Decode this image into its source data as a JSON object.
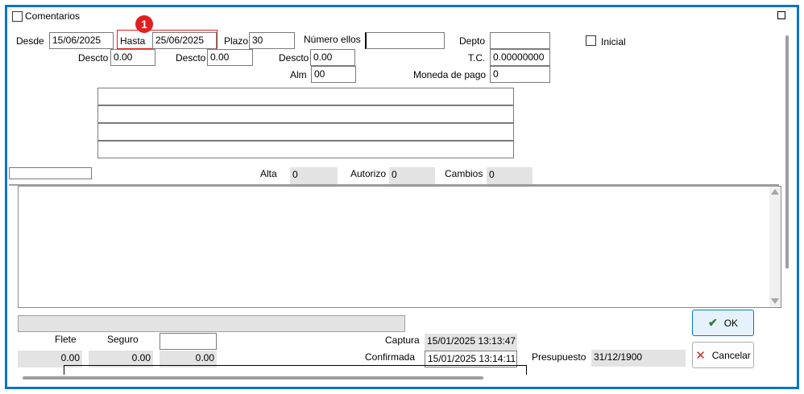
{
  "header": {
    "comentarios_label": "Comentarios"
  },
  "badge": "1",
  "row1": {
    "desde_label": "Desde",
    "desde_value": "15/06/2025",
    "hasta_label": "Hasta",
    "hasta_value": "25/06/2025",
    "plazo_label": "Plazo",
    "plazo_value": "30",
    "numero_label": "Número ellos",
    "numero_value": "",
    "depto_label": "Depto",
    "depto_value": "",
    "inicial_label": "Inicial"
  },
  "row2": {
    "descto1_label": "Descto",
    "descto1_value": "0.00",
    "descto2_label": "Descto",
    "descto2_value": "0.00",
    "descto3_label": "Descto",
    "descto3_value": "0.00",
    "tc_label": "T.C.",
    "tc_value": "0.00000000"
  },
  "row3": {
    "alm_label": "Alm",
    "alm_value": "00",
    "moneda_label": "Moneda de pago",
    "moneda_value": "0"
  },
  "status": {
    "alta_label": "Alta",
    "alta_value": "0",
    "autorizo_label": "Autorizo",
    "autorizo_value": "0",
    "cambios_label": "Cambios",
    "cambios_value": "0"
  },
  "bottom": {
    "flete_label": "Flete",
    "flete_value": "0.00",
    "seguro_label": "Seguro",
    "seguro_value": "0.00",
    "third_value": "0.00",
    "captura_label": "Captura",
    "captura_value": "15/01/2025 13:13:47",
    "confirmada_label": "Confirmada",
    "confirmada_value": "15/01/2025 13:14:11",
    "presupuesto_label": "Presupuesto",
    "presupuesto_value": "31/12/1900"
  },
  "buttons": {
    "ok_label": "OK",
    "cancel_label": "Cancelar"
  },
  "colors": {
    "frame": "#0b73c9",
    "highlight": "#e02020",
    "readonly": "#e3e3e3",
    "ok_check": "#2e7d32",
    "cancel_x": "#c62828"
  },
  "icons": [
    "maximize-icon",
    "checkmark-icon",
    "close-x-icon",
    "scroll-up-icon",
    "scroll-down-icon"
  ]
}
